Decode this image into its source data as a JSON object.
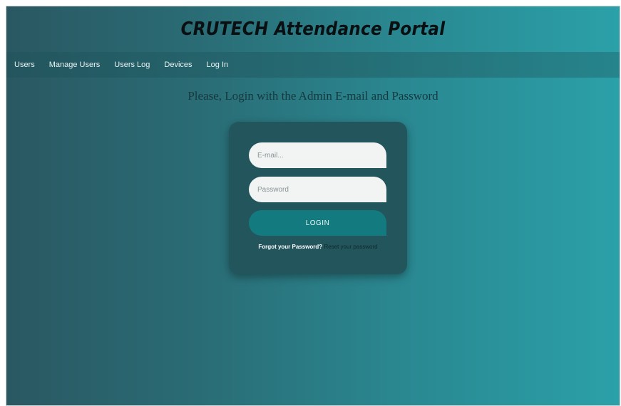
{
  "header": {
    "title": "CRUTECH Attendance Portal"
  },
  "nav": {
    "items": [
      {
        "label": "Users"
      },
      {
        "label": "Manage Users"
      },
      {
        "label": "Users Log"
      },
      {
        "label": "Devices"
      },
      {
        "label": "Log In"
      }
    ]
  },
  "login": {
    "prompt": "Please, Login with the Admin E-mail and Password",
    "email_placeholder": "E-mail...",
    "password_placeholder": "Password",
    "button_label": "LOGIN",
    "forgot_text": "Forgot your Password?",
    "reset_link": "Reset your password"
  },
  "colors": {
    "background_start": "#2a5862",
    "background_end": "#2ba0a8",
    "card": "#23555d",
    "button": "#137b7f"
  }
}
